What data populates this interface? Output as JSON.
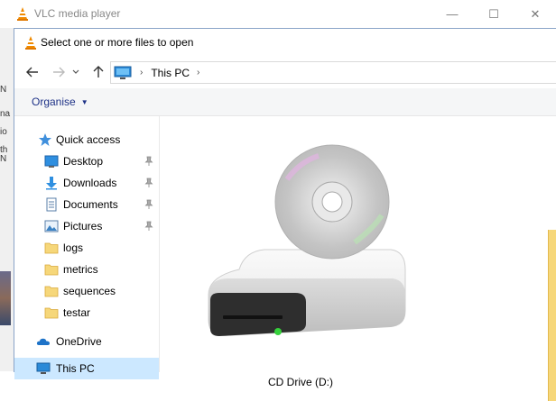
{
  "vlc": {
    "title": "VLC media player",
    "controls": {
      "minimize": "—",
      "maximize": "☐",
      "close": "✕"
    },
    "left_strip_marks": [
      "N",
      "na",
      "io",
      "th",
      "N"
    ]
  },
  "dialog": {
    "title": "Select one or more files to open",
    "address": {
      "crumb": "This PC"
    },
    "toolbar": {
      "organise_label": "Organise"
    },
    "nav": {
      "quick_access": "Quick access",
      "items": [
        {
          "label": "Desktop",
          "icon": "desktop-icon",
          "pinned": true
        },
        {
          "label": "Downloads",
          "icon": "download-icon",
          "pinned": true
        },
        {
          "label": "Documents",
          "icon": "documents-icon",
          "pinned": true
        },
        {
          "label": "Pictures",
          "icon": "pictures-icon",
          "pinned": true
        },
        {
          "label": "logs",
          "icon": "folder-icon",
          "pinned": false
        },
        {
          "label": "metrics",
          "icon": "folder-icon",
          "pinned": false
        },
        {
          "label": "sequences",
          "icon": "folder-icon",
          "pinned": false
        },
        {
          "label": "testar",
          "icon": "folder-icon",
          "pinned": false
        }
      ],
      "onedrive": "OneDrive",
      "this_pc": "This PC"
    },
    "content": {
      "items": [
        {
          "label": "CD Drive (D:)",
          "icon": "cd-drive-icon"
        }
      ]
    }
  },
  "colors": {
    "accent": "#1e3287",
    "selected_bg": "#cce8ff",
    "folder": "#f6d77a"
  }
}
